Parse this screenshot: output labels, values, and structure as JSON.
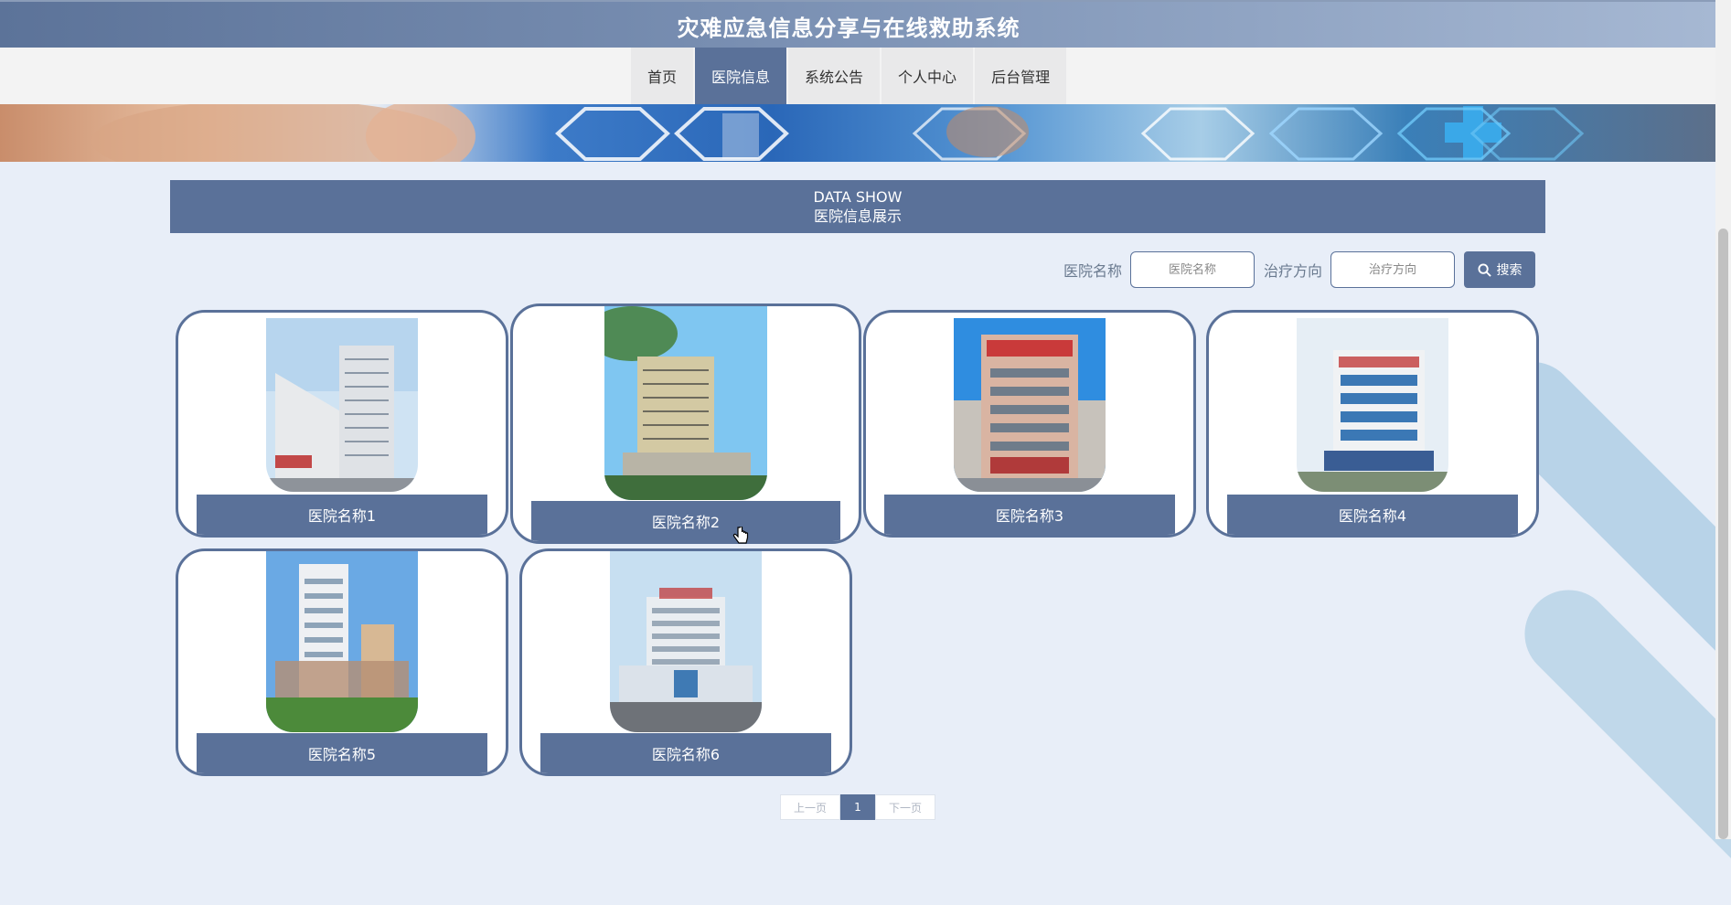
{
  "header": {
    "title": "灾难应急信息分享与在线救助系统"
  },
  "nav": {
    "items": [
      {
        "label": "首页"
      },
      {
        "label": "医院信息"
      },
      {
        "label": "系统公告"
      },
      {
        "label": "个人中心"
      },
      {
        "label": "后台管理"
      }
    ],
    "active_index": 1
  },
  "section": {
    "title_en": "DATA SHOW",
    "title_cn": "医院信息展示"
  },
  "search": {
    "name_label": "医院名称",
    "name_placeholder": "医院名称",
    "direction_label": "治疗方向",
    "direction_placeholder": "治疗方向",
    "button_label": "搜索"
  },
  "hospitals": [
    {
      "name": "医院名称1"
    },
    {
      "name": "医院名称2"
    },
    {
      "name": "医院名称3"
    },
    {
      "name": "医院名称4"
    },
    {
      "name": "医院名称5"
    },
    {
      "name": "医院名称6"
    }
  ],
  "pagination": {
    "prev": "上一页",
    "current": "1",
    "next": "下一页"
  },
  "colors": {
    "primary": "#5a7199",
    "background": "#e8eef8",
    "accent_stripe": "#b8d3e8"
  }
}
